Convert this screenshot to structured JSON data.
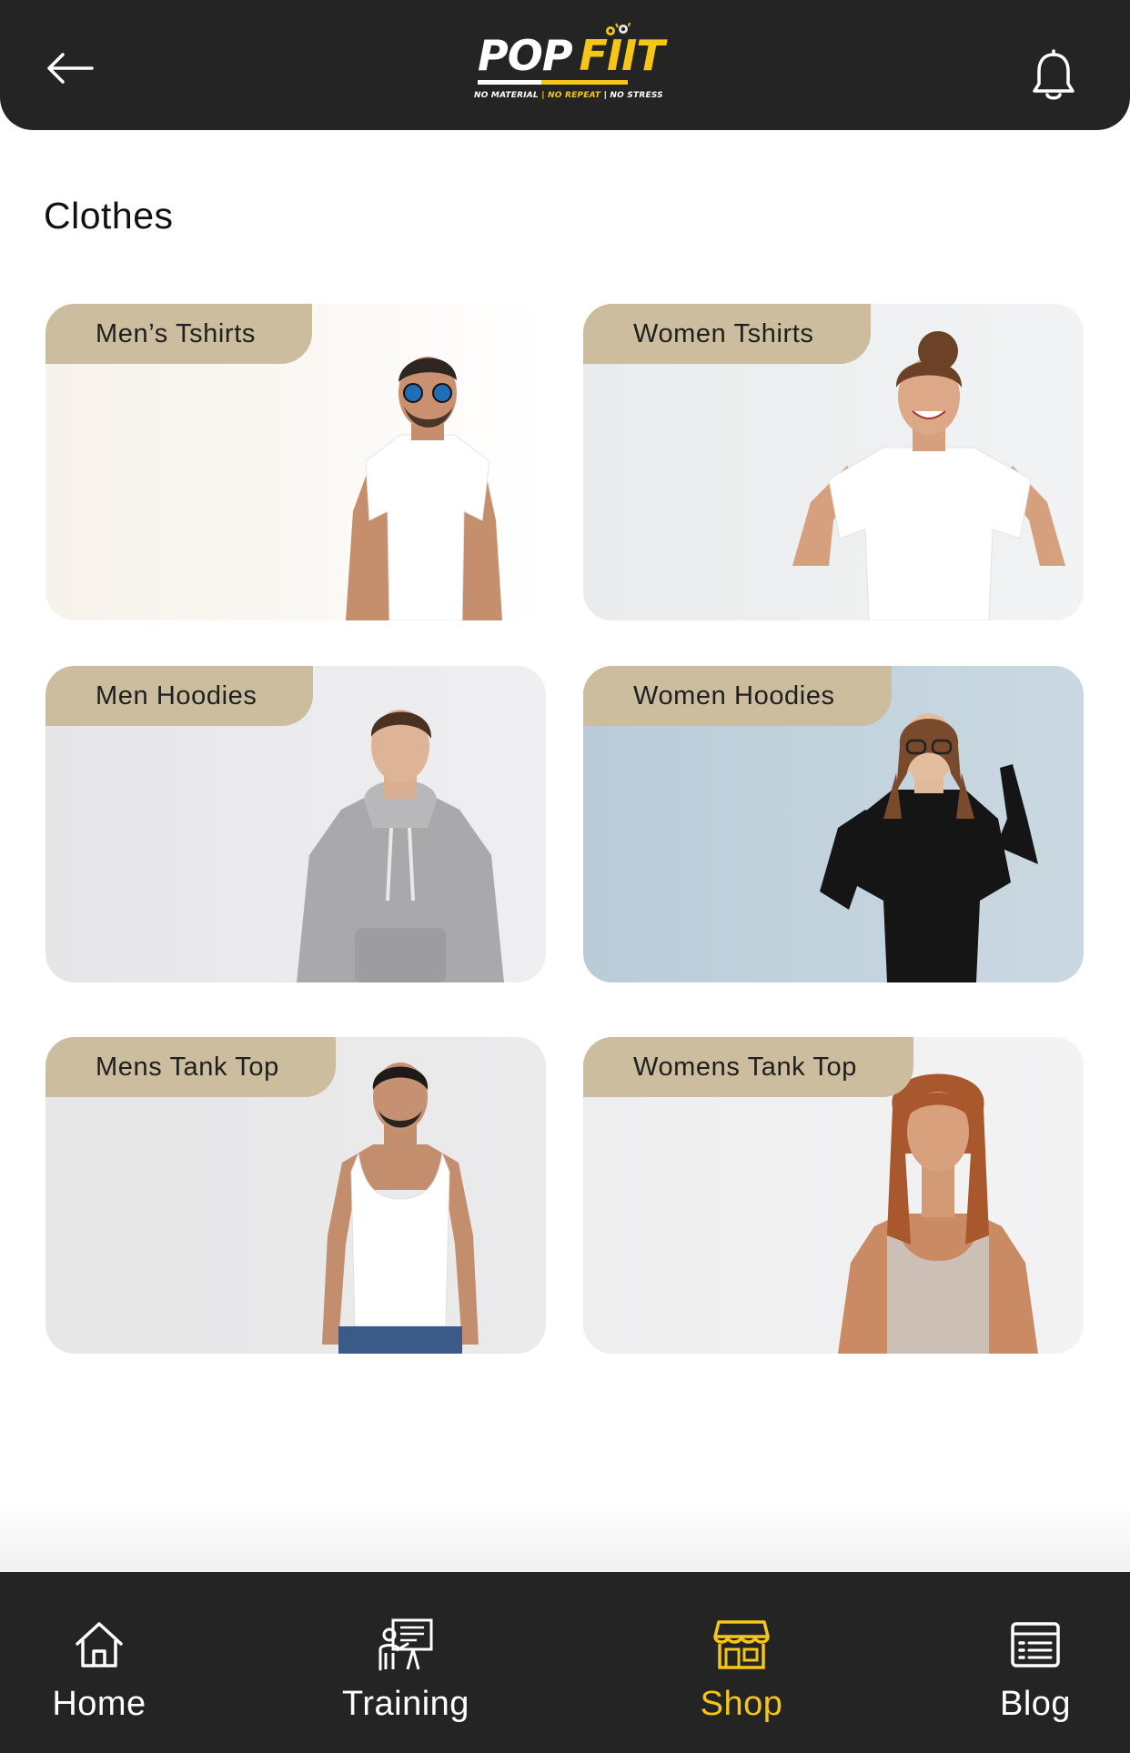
{
  "header": {
    "logo": {
      "pop": "POP",
      "fit": "FIIT",
      "tagline_1": "NO MATERIAL",
      "tagline_2": "NO REPEAT",
      "tagline_3": "NO STRESS",
      "separator": "|"
    },
    "back_icon": "arrow-left-icon",
    "notification_icon": "bell-icon"
  },
  "page": {
    "title": "Clothes"
  },
  "categories": [
    {
      "label": "Men’s Tshirts",
      "image": "man-white-tshirt-sunglasses"
    },
    {
      "label": "Women Tshirts",
      "image": "woman-white-tshirt-pointing"
    },
    {
      "label": "Men Hoodies",
      "image": "man-grey-hoodie"
    },
    {
      "label": "Women Hoodies",
      "image": "woman-black-hoodie-glasses"
    },
    {
      "label": "Mens Tank Top",
      "image": "man-white-tank-top"
    },
    {
      "label": "Womens Tank Top",
      "image": "woman-beige-tank-top"
    }
  ],
  "bottom_nav": [
    {
      "label": "Home",
      "icon": "home-icon",
      "active": false
    },
    {
      "label": "Training",
      "icon": "training-icon",
      "active": false
    },
    {
      "label": "Shop",
      "icon": "shop-icon",
      "active": true
    },
    {
      "label": "Blog",
      "icon": "blog-icon",
      "active": false
    }
  ],
  "colors": {
    "header_bg": "#242424",
    "accent": "#f5c518",
    "tag_bg": "#cbbd9e",
    "nav_bg": "#242424"
  }
}
